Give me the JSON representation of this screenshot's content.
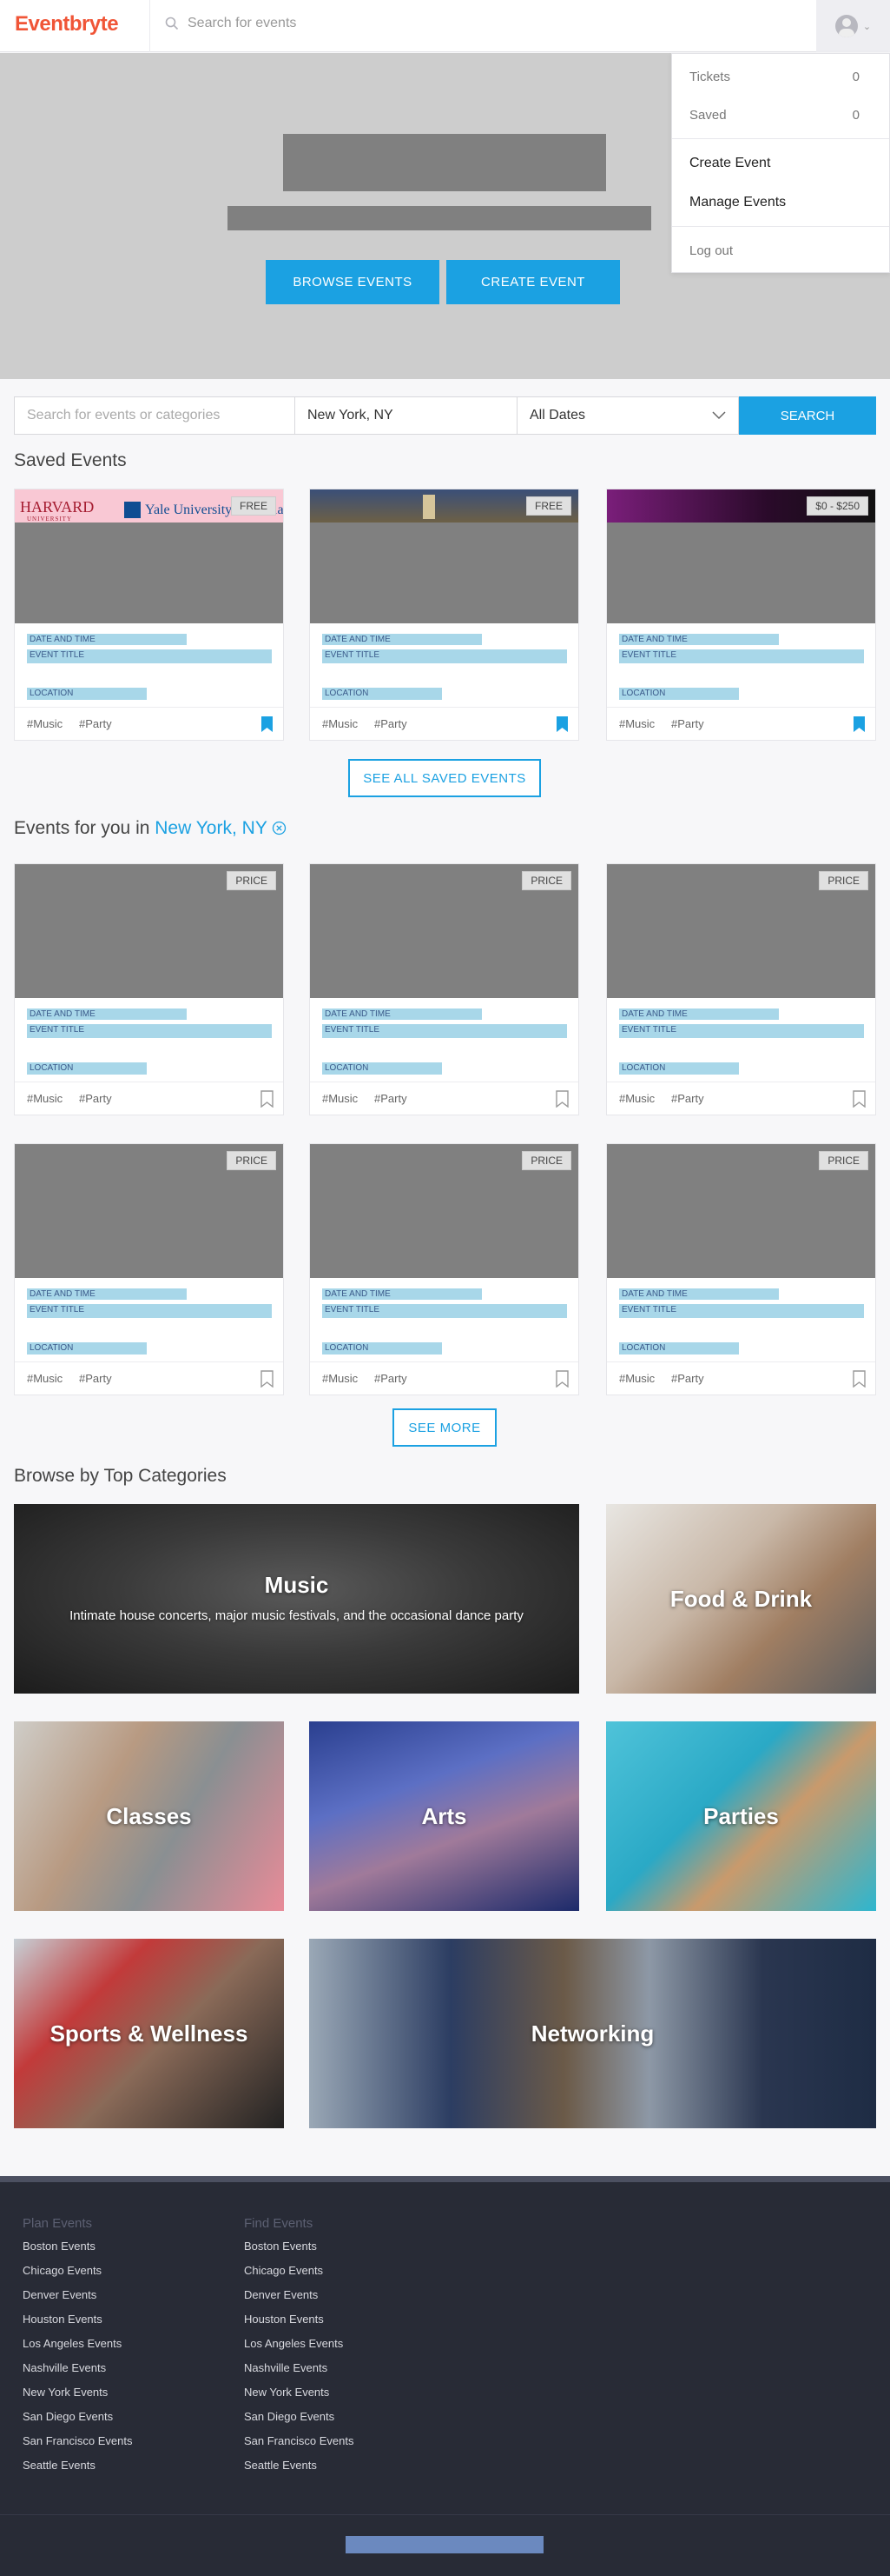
{
  "header": {
    "logo": "Eventbryte",
    "search_placeholder": "Search for events"
  },
  "hero": {
    "browse_label": "BROWSE EVENTS",
    "create_label": "CREATE EVENT"
  },
  "user_menu": {
    "tickets_label": "Tickets",
    "tickets_count": "0",
    "saved_label": "Saved",
    "saved_count": "0",
    "create_event": "Create Event",
    "manage_events": "Manage Events",
    "log_out": "Log out"
  },
  "filters": {
    "query_placeholder": "Search for events or categories",
    "location": "New York, NY",
    "date": "All Dates",
    "search_label": "SEARCH"
  },
  "saved": {
    "title": "Saved Events",
    "see_all_label": "SEE ALL SAVED EVENTS",
    "cards": [
      {
        "badge": "FREE",
        "date": "DATE AND TIME",
        "title": "EVENT TITLE",
        "location": "LOCATION",
        "tags": [
          "#Music",
          "#Party"
        ],
        "saved": true,
        "image_text": [
          "HARVARD",
          "UNIVERSITY",
          "Yale University",
          "la"
        ]
      },
      {
        "badge": "FREE",
        "date": "DATE AND TIME",
        "title": "EVENT TITLE",
        "location": "LOCATION",
        "tags": [
          "#Music",
          "#Party"
        ],
        "saved": true
      },
      {
        "badge": "$0 - $250",
        "date": "DATE AND TIME",
        "title": "EVENT TITLE",
        "location": "LOCATION",
        "tags": [
          "#Music",
          "#Party"
        ],
        "saved": true
      }
    ]
  },
  "for_you": {
    "title_prefix": "Events for you in",
    "location": "New York, NY",
    "see_more_label": "SEE MORE",
    "cards": [
      {
        "badge": "PRICE",
        "date": "DATE AND TIME",
        "title": "EVENT TITLE",
        "location": "LOCATION",
        "tags": [
          "#Music",
          "#Party"
        ]
      },
      {
        "badge": "PRICE",
        "date": "DATE AND TIME",
        "title": "EVENT TITLE",
        "location": "LOCATION",
        "tags": [
          "#Music",
          "#Party"
        ]
      },
      {
        "badge": "PRICE",
        "date": "DATE AND TIME",
        "title": "EVENT TITLE",
        "location": "LOCATION",
        "tags": [
          "#Music",
          "#Party"
        ]
      },
      {
        "badge": "PRICE",
        "date": "DATE AND TIME",
        "title": "EVENT TITLE",
        "location": "LOCATION",
        "tags": [
          "#Music",
          "#Party"
        ]
      },
      {
        "badge": "PRICE",
        "date": "DATE AND TIME",
        "title": "EVENT TITLE",
        "location": "LOCATION",
        "tags": [
          "#Music",
          "#Party"
        ]
      },
      {
        "badge": "PRICE",
        "date": "DATE AND TIME",
        "title": "EVENT TITLE",
        "location": "LOCATION",
        "tags": [
          "#Music",
          "#Party"
        ]
      }
    ]
  },
  "categories": {
    "title": "Browse by Top Categories",
    "items": [
      {
        "name": "Music",
        "description": "Intimate house concerts, major music festivals, and the occasional dance party"
      },
      {
        "name": "Food & Drink"
      },
      {
        "name": "Classes"
      },
      {
        "name": "Arts"
      },
      {
        "name": "Parties"
      },
      {
        "name": "Sports & Wellness"
      },
      {
        "name": "Networking"
      }
    ]
  },
  "footer": {
    "plan_title": "Plan Events",
    "find_title": "Find Events",
    "plan_links": [
      "Boston Events",
      "Chicago Events",
      "Denver Events",
      "Houston Events",
      "Los Angeles Events",
      "Nashville Events",
      "New York Events",
      "San Diego Events",
      "San Francisco Events",
      "Seattle Events"
    ],
    "find_links": [
      "Boston Events",
      "Chicago Events",
      "Denver Events",
      "Houston Events",
      "Los Angeles Events",
      "Nashville Events",
      "New York Events",
      "San Diego Events",
      "San Francisco Events",
      "Seattle Events"
    ]
  },
  "colors": {
    "brand": "#f05537",
    "accent": "#1ba1e2",
    "placeholder_bar": "#a8d7e9",
    "footer_bg": "#282b36"
  }
}
